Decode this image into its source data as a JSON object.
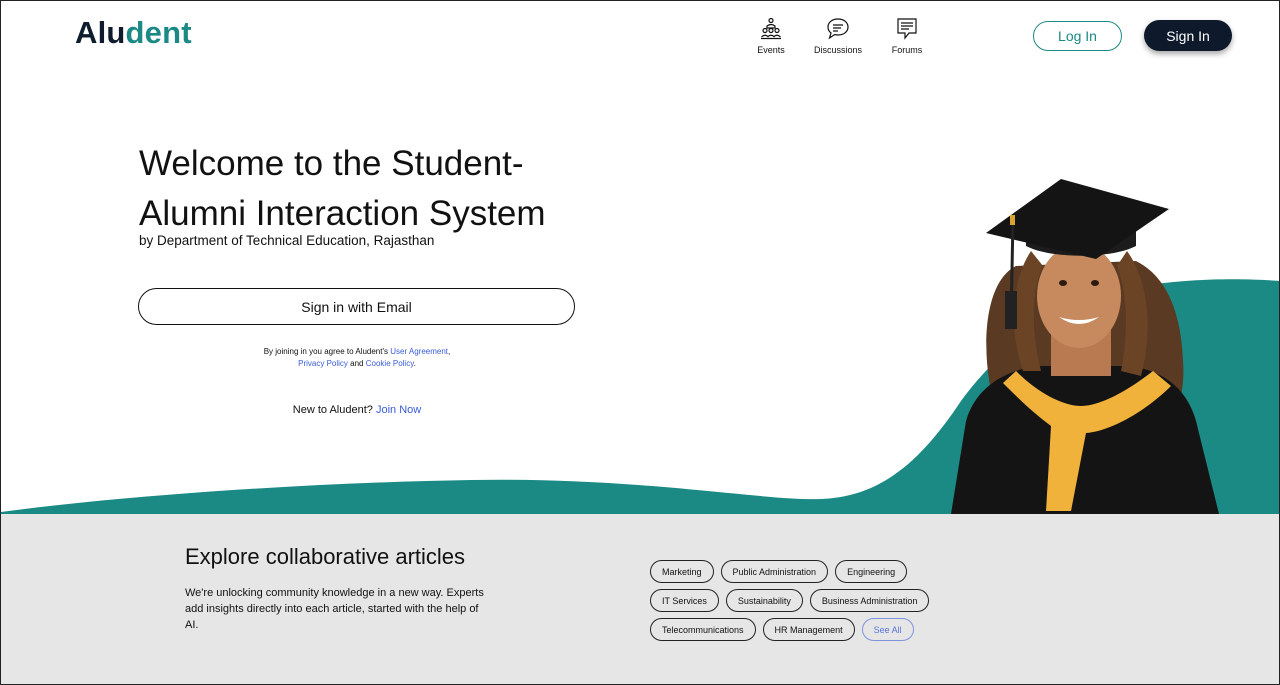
{
  "header": {
    "logo_part1": "Alu",
    "logo_part2": "dent",
    "nav": [
      {
        "label": "Events",
        "icon": "events-icon"
      },
      {
        "label": "Discussions",
        "icon": "discussions-icon"
      },
      {
        "label": "Forums",
        "icon": "forums-icon"
      }
    ],
    "login_label": "Log In",
    "signin_label": "Sign In"
  },
  "hero": {
    "title_line1": "Welcome to the Student-",
    "title_line2": "Alumni Interaction System",
    "subtitle": "by Department of Technical Education, Rajasthan",
    "email_button": "Sign in with Email",
    "agree_prefix": "By joining in you agree to Aludent's ",
    "agree_user_agreement": "User Agreement",
    "agree_comma": ",",
    "agree_privacy": "Privacy Policy",
    "agree_and": " and ",
    "agree_cookie": "Cookie Policy",
    "agree_end": ".",
    "new_prefix": "New to Aludent? ",
    "join_now": "Join Now"
  },
  "articles": {
    "title": "Explore collaborative articles",
    "description": "We're unlocking community knowledge in a new way. Experts add insights directly into each article, started with the help of AI.",
    "tags_row1": [
      "Marketing",
      "Public Administration",
      "Engineering"
    ],
    "tags_row2": [
      "IT Services",
      "Sustainability",
      "Business Administration"
    ],
    "tags_row3": [
      "Telecommunications",
      "HR Management"
    ],
    "see_all": "See All"
  },
  "colors": {
    "teal": "#1b8a84",
    "navy": "#0e1a2b",
    "link_blue": "#3a5bd9",
    "bottom_bg": "#e6e6e6"
  }
}
